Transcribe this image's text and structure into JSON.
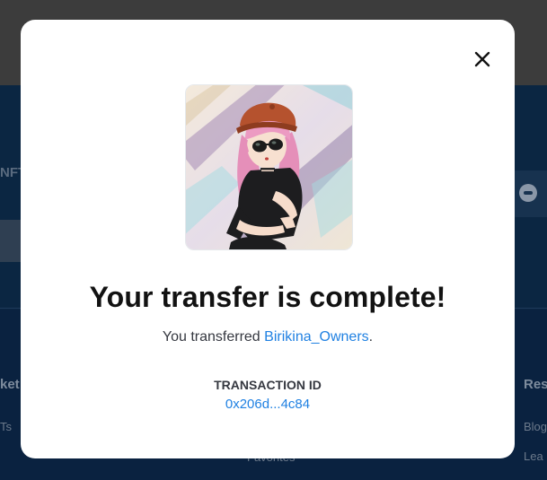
{
  "background": {
    "nft_fragment": "NFT",
    "market_fragment": "ket",
    "resources_fragment": "Res",
    "nfts_fragment": "Ts",
    "blog_fragment": "Blog",
    "learn_fragment": "Lea",
    "favorites_fragment": "Favorites"
  },
  "modal": {
    "close_icon": "close-icon",
    "image_alt": "Birikina_Owners",
    "title": "Your transfer is complete!",
    "subtitle_prefix": "You transferred ",
    "recipient": "Birikina_Owners",
    "subtitle_suffix": ".",
    "transaction_label": "TRANSACTION ID",
    "transaction_id": "0x206d...4c84"
  },
  "colors": {
    "link": "#2081e2",
    "title": "#121212",
    "overlay_dark": "#3c3c3c",
    "page_navy": "#0b2642"
  }
}
